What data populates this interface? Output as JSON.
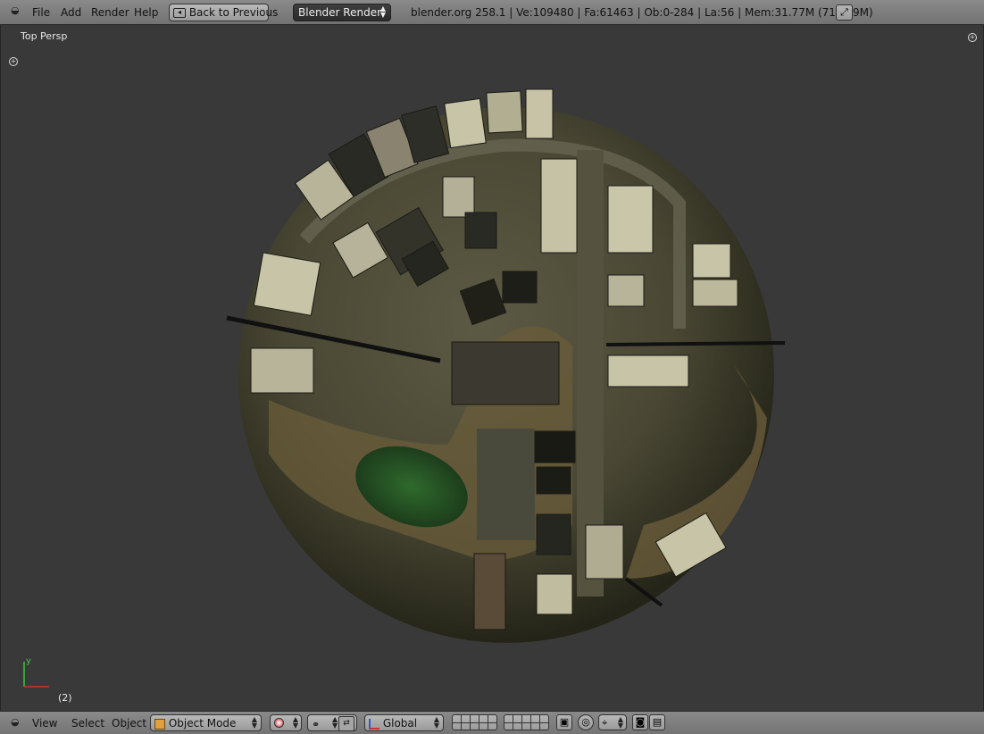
{
  "header": {
    "menu": [
      "File",
      "Add",
      "Render",
      "Help"
    ],
    "back_button": "Back to Previous",
    "render_engine": "Blender Render",
    "stats": "blender.org 258.1 | Ve:109480 | Fa:61463 | Ob:0-284 | La:56 | Mem:31.77M (718.49M)"
  },
  "viewport": {
    "view_label": "Top Persp",
    "frame_label": "(2)",
    "axis": {
      "y": "y"
    }
  },
  "footer": {
    "menu": [
      "View",
      "Select",
      "Object"
    ],
    "mode": "Object Mode",
    "orientation": "Global"
  },
  "icons": [
    "editor-type-icon",
    "fullscreen-icon",
    "object-mode-cube-icon",
    "viewport-shading-icon",
    "pivot-icon",
    "manipulator-icon",
    "layers-grid-icon",
    "lock-icon",
    "proportional-icon",
    "snap-icon",
    "render-camera-icon",
    "clapper-icon"
  ]
}
